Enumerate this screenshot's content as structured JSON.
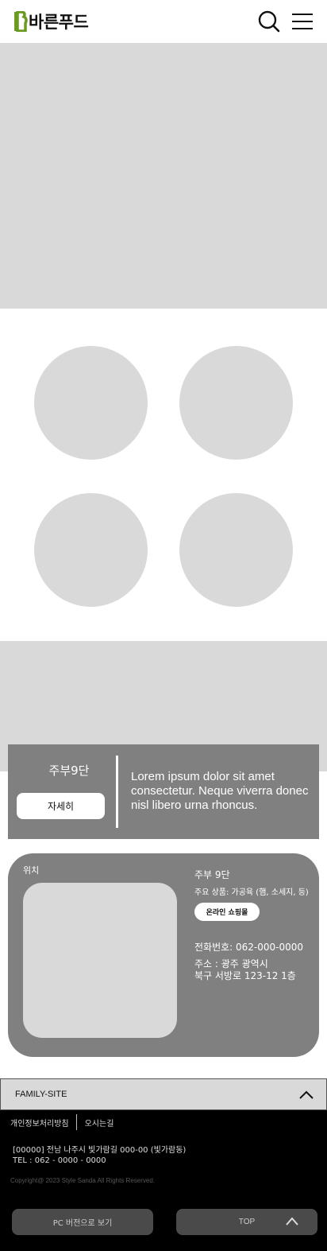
{
  "header": {
    "logo_text": "바른푸드",
    "brand_color": "#6a9a1f",
    "search_icon": "search-icon",
    "menu_icon": "hamburger-menu-icon"
  },
  "hero": {
    "placeholder": ""
  },
  "promo": {
    "title": "주부9단",
    "button_label": "자세히",
    "text": "Lorem ipsum dolor sit amet consectetur. Neque viverra donec nisl libero urna rhoncus."
  },
  "location": {
    "label": "위치",
    "name": "주부 9단",
    "products": "주요 상품: 가공육 (햄, 소세지, 등)",
    "shop_button": "온라인 쇼핑몰",
    "tel": "전화번호: 062-000-0000",
    "address_line1": "주소 : 광주 광역시",
    "address_line2": "북구 서방로 123-12 1층"
  },
  "footer": {
    "family_site": "FAMILY-SITE",
    "links": [
      "개인정보처리방침",
      "오시는길"
    ],
    "address": "[00000] 전남 나주시 빛가람길 000-00 (빛가람동)",
    "tel": "TEL : 062 - 0000 - 0000",
    "copyright": "Copyright@ 2023 Style Sanda All Rights Reserved.",
    "pc_button": "PC 버전으로 보기",
    "top_button": "TOP"
  },
  "colors": {
    "placeholder_gray": "#d9d9d9",
    "card_gray": "#808080",
    "footer_bg": "#000000"
  }
}
